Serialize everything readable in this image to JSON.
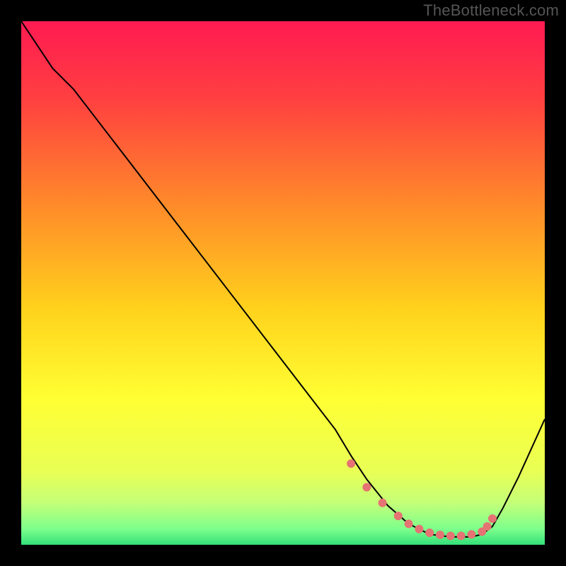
{
  "watermark": "TheBottleneck.com",
  "chart_data": {
    "type": "line",
    "title": "",
    "xlabel": "",
    "ylabel": "",
    "xlim": [
      0,
      100
    ],
    "ylim": [
      0,
      100
    ],
    "grid": false,
    "legend": false,
    "background_gradient": {
      "direction": "vertical",
      "stops": [
        {
          "offset": 0.0,
          "color": "#ff1a52"
        },
        {
          "offset": 0.15,
          "color": "#ff4040"
        },
        {
          "offset": 0.35,
          "color": "#ff8a2a"
        },
        {
          "offset": 0.55,
          "color": "#ffd21c"
        },
        {
          "offset": 0.72,
          "color": "#ffff33"
        },
        {
          "offset": 0.86,
          "color": "#e9ff55"
        },
        {
          "offset": 0.92,
          "color": "#c4ff78"
        },
        {
          "offset": 0.97,
          "color": "#7dff8c"
        },
        {
          "offset": 1.0,
          "color": "#33e07a"
        }
      ]
    },
    "series": [
      {
        "name": "curve",
        "stroke": "#000000",
        "stroke_width": 2,
        "x": [
          0,
          6,
          10,
          15,
          20,
          25,
          30,
          35,
          40,
          45,
          50,
          55,
          60,
          63,
          66,
          70,
          74,
          78,
          82,
          86,
          88,
          90,
          92,
          95,
          100
        ],
        "y": [
          100,
          91,
          87,
          80.5,
          74,
          67.5,
          61,
          54.5,
          48,
          41.5,
          35,
          28.5,
          22,
          17,
          12.5,
          7.5,
          4,
          2,
          1.5,
          1.5,
          2,
          3.5,
          7,
          13,
          24
        ]
      }
    ],
    "markers": {
      "name": "flat-region-dots",
      "color": "#e57373",
      "radius": 6,
      "x": [
        63,
        66,
        69,
        72,
        74,
        76,
        78,
        80,
        82,
        84,
        86,
        88,
        89,
        90
      ],
      "y": [
        15.5,
        11,
        8,
        5.5,
        4,
        3,
        2.3,
        1.9,
        1.7,
        1.7,
        2,
        2.5,
        3.5,
        5
      ]
    }
  }
}
